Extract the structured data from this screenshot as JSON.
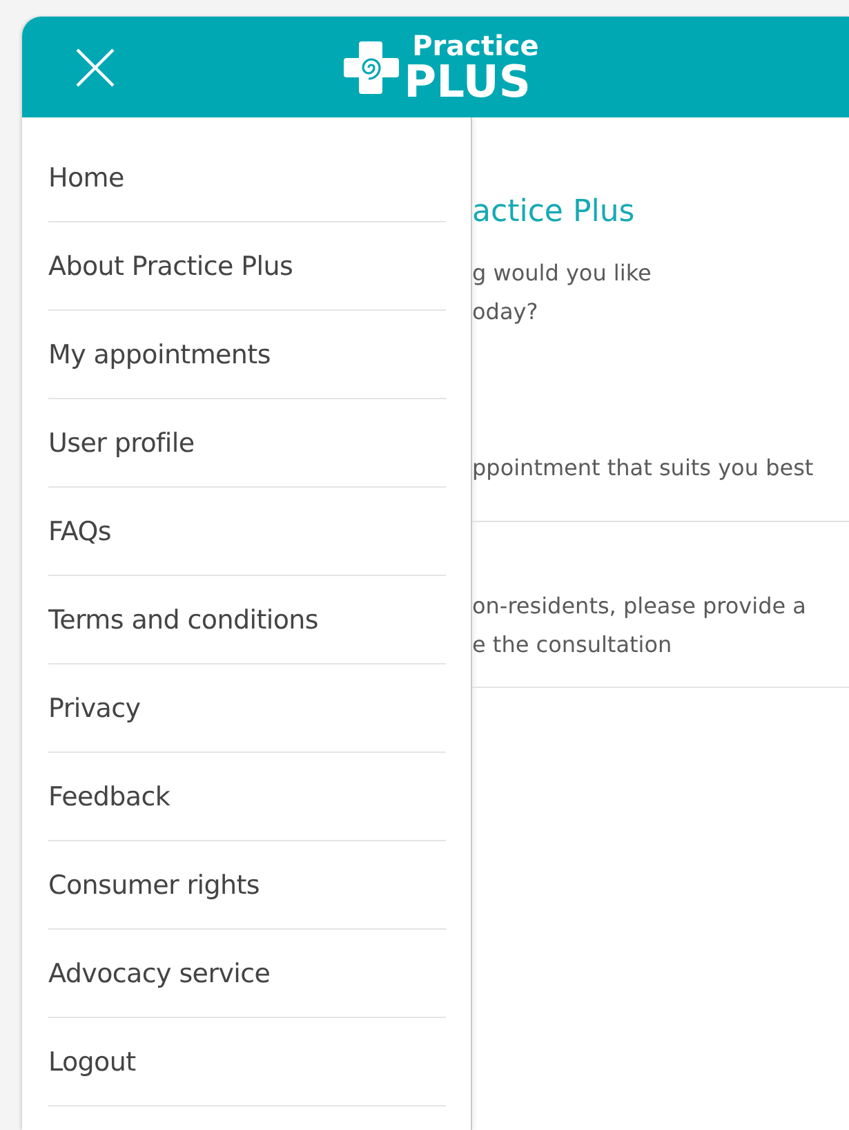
{
  "header": {
    "logo_top": "Practice",
    "logo_bottom": "PLUS"
  },
  "menu": [
    {
      "label": "Home"
    },
    {
      "label": "About Practice Plus"
    },
    {
      "label": "My appointments"
    },
    {
      "label": "User profile"
    },
    {
      "label": "FAQs"
    },
    {
      "label": "Terms and conditions"
    },
    {
      "label": "Privacy"
    },
    {
      "label": "Feedback"
    },
    {
      "label": "Consumer rights"
    },
    {
      "label": "Advocacy service"
    },
    {
      "label": "Logout"
    }
  ],
  "content": {
    "heading": "actice Plus",
    "question": [
      "g would you like",
      "oday?"
    ],
    "sections": [
      {
        "lines": [
          "ppointment that suits you best"
        ]
      },
      {
        "lines": [
          "on-residents, please provide a",
          "e the consultation"
        ]
      }
    ]
  }
}
